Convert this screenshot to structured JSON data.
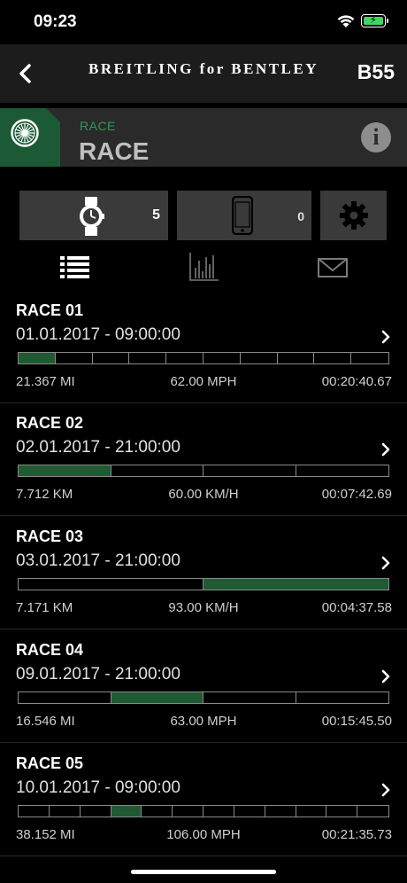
{
  "status": {
    "time": "09:23"
  },
  "navbar": {
    "brand": "BREITLING for BENTLEY",
    "model": "B55"
  },
  "mode": {
    "subtitle": "RACE",
    "title": "RACE"
  },
  "devices": {
    "watch_count": "5",
    "phone_count": "0"
  },
  "tabs": [
    "list",
    "chart",
    "mail"
  ],
  "colors": {
    "accent": "#1f5a33",
    "header_green": "#2f9a55",
    "background": "#000000"
  },
  "races": [
    {
      "name": "RACE 01",
      "date": "01.01.2017 - 09:00:00",
      "distance": "21.367 MI",
      "speed": "62.00 MPH",
      "duration": "00:20:40.67",
      "segments": 10,
      "active": [
        0
      ]
    },
    {
      "name": "RACE 02",
      "date": "02.01.2017 - 21:00:00",
      "distance": "7.712 KM",
      "speed": "60.00 KM/H",
      "duration": "00:07:42.69",
      "segments": 4,
      "active": [
        0
      ]
    },
    {
      "name": "RACE 03",
      "date": "03.01.2017 - 21:00:00",
      "distance": "7.171 KM",
      "speed": "93.00 KM/H",
      "duration": "00:04:37.58",
      "segments": 2,
      "active": [
        1
      ]
    },
    {
      "name": "RACE 04",
      "date": "09.01.2017 - 21:00:00",
      "distance": "16.546 MI",
      "speed": "63.00 MPH",
      "duration": "00:15:45.50",
      "segments": 4,
      "active": [
        1
      ]
    },
    {
      "name": "RACE 05",
      "date": "10.01.2017 - 09:00:00",
      "distance": "38.152 MI",
      "speed": "106.00 MPH",
      "duration": "00:21:35.73",
      "segments": 12,
      "active": [
        3
      ]
    }
  ]
}
